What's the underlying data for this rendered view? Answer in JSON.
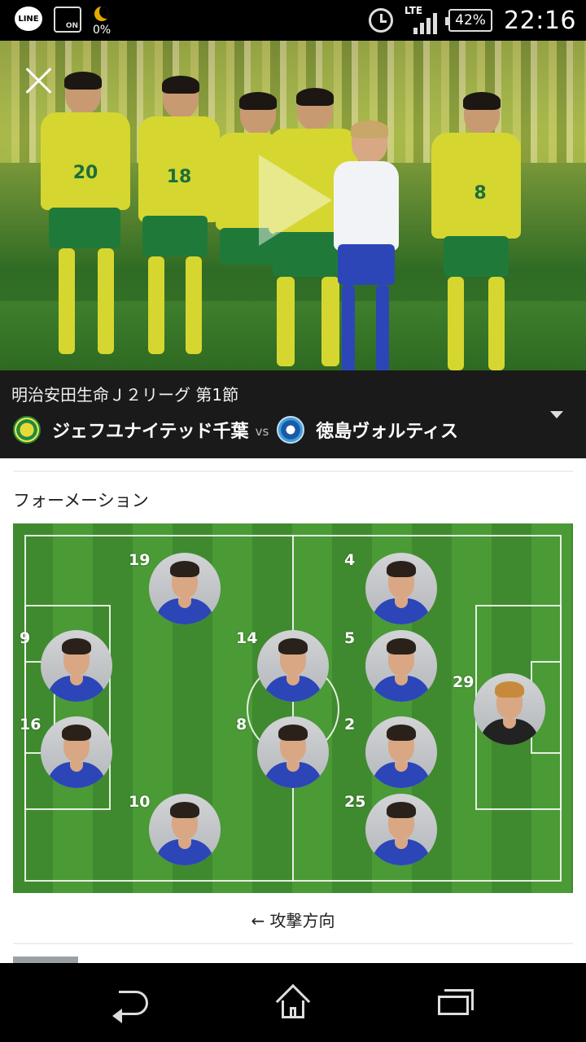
{
  "status_bar": {
    "battery": "42%",
    "time": "22:16",
    "network": "LTE",
    "data_usage": "0%",
    "icons": [
      "line-icon",
      "wifi-on-icon",
      "moon-icon",
      "alarm-icon",
      "signal-icon",
      "battery-icon"
    ],
    "line_label": "LINE",
    "wifi_label": "ON"
  },
  "hero": {
    "icons": [
      "close-icon",
      "play-icon"
    ]
  },
  "match": {
    "league": "明治安田生命Ｊ２リーグ 第1節",
    "home_team": "ジェフユナイテッド千葉",
    "vs": "vs",
    "away_team": "徳島ヴォルティス"
  },
  "formation": {
    "title": "フォーメーション",
    "attack_direction": "← 攻撃方向",
    "players": [
      {
        "number": "19",
        "gk": false
      },
      {
        "number": "4",
        "gk": false
      },
      {
        "number": "9",
        "gk": false
      },
      {
        "number": "14",
        "gk": false
      },
      {
        "number": "5",
        "gk": false
      },
      {
        "number": "29",
        "gk": true
      },
      {
        "number": "16",
        "gk": false
      },
      {
        "number": "8",
        "gk": false
      },
      {
        "number": "2",
        "gk": false
      },
      {
        "number": "10",
        "gk": false
      },
      {
        "number": "25",
        "gk": false
      }
    ]
  },
  "colors": {
    "pitch_green": "#4a9a36",
    "home_jersey": "#d6d631",
    "away_jersey": "#2c46b8",
    "header_bg": "#1a1a1a"
  },
  "nav_bar": {
    "icons": [
      "back-icon",
      "home-icon",
      "recent-apps-icon"
    ]
  }
}
